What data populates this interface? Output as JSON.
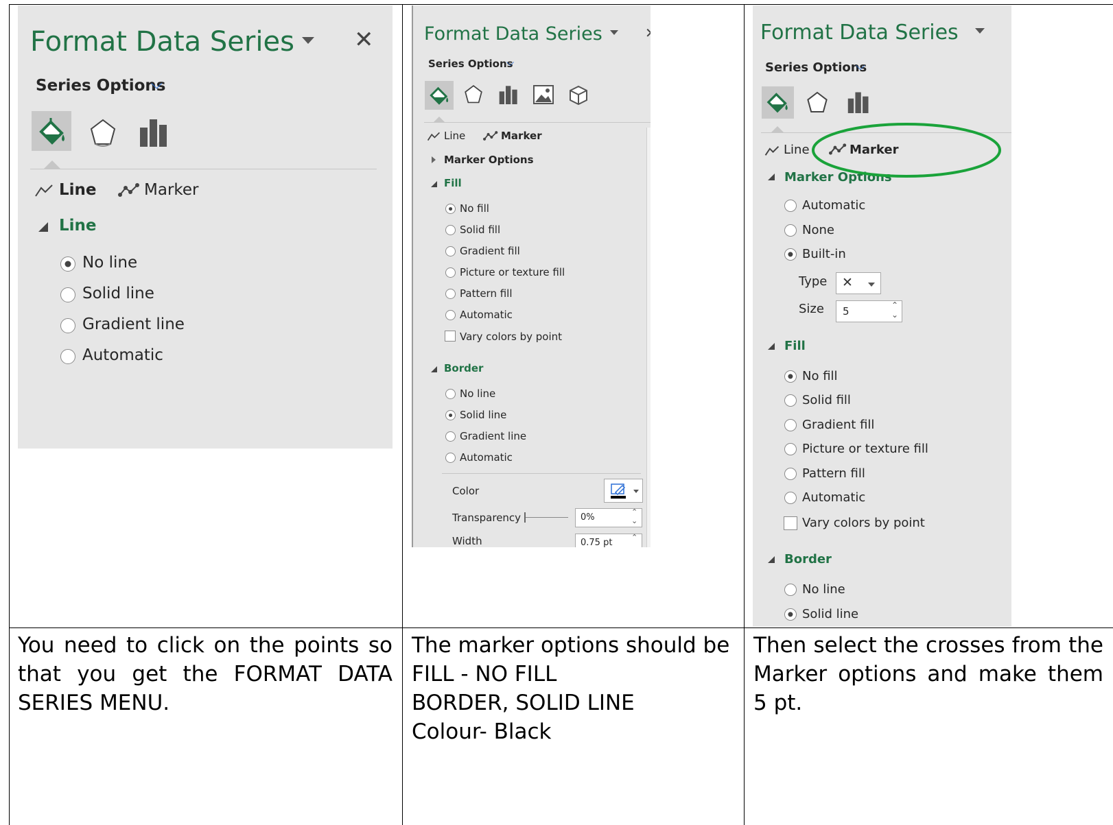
{
  "panel_title": "Format Data Series",
  "series_options": "Series Options",
  "tabs": {
    "line": "Line",
    "marker": "Marker"
  },
  "panel1": {
    "section": "Line",
    "options": [
      "No line",
      "Solid line",
      "Gradient line",
      "Automatic"
    ],
    "selected": 0
  },
  "panel2": {
    "marker_options": "Marker Options",
    "fill_section": "Fill",
    "fill_options": [
      "No fill",
      "Solid fill",
      "Gradient fill",
      "Picture or texture fill",
      "Pattern fill",
      "Automatic"
    ],
    "vary": "Vary colors by point",
    "border_section": "Border",
    "border_options": [
      "No line",
      "Solid line",
      "Gradient line",
      "Automatic"
    ],
    "color_label": "Color",
    "transparency_label": "Transparency",
    "transparency_value": "0%",
    "width_label": "Width",
    "width_value": "0.75 pt"
  },
  "panel3": {
    "marker_options": "Marker Options",
    "marker_choices": [
      "Automatic",
      "None",
      "Built-in"
    ],
    "type_label": "Type",
    "type_value": "✕",
    "size_label": "Size",
    "size_value": "5",
    "fill_section": "Fill",
    "fill_options": [
      "No fill",
      "Solid fill",
      "Gradient fill",
      "Picture or texture fill",
      "Pattern fill",
      "Automatic"
    ],
    "vary": "Vary colors by point",
    "border_section": "Border",
    "border_options": [
      "No line",
      "Solid line"
    ]
  },
  "captions": {
    "col1": "You need to click on the points so that you get the FORMAT DATA SERIES MENU.",
    "col2_line1": "The marker options should be",
    "col2_line2": "FILL - NO FILL",
    "col2_line3": "BORDER, SOLID LINE",
    "col2_line4": "Colour- Black",
    "col3": "Then select the crosses from the Marker options and make them 5 pt."
  },
  "colors": {
    "accent": "#217346",
    "highlight_ellipse": "#1aa33a"
  }
}
